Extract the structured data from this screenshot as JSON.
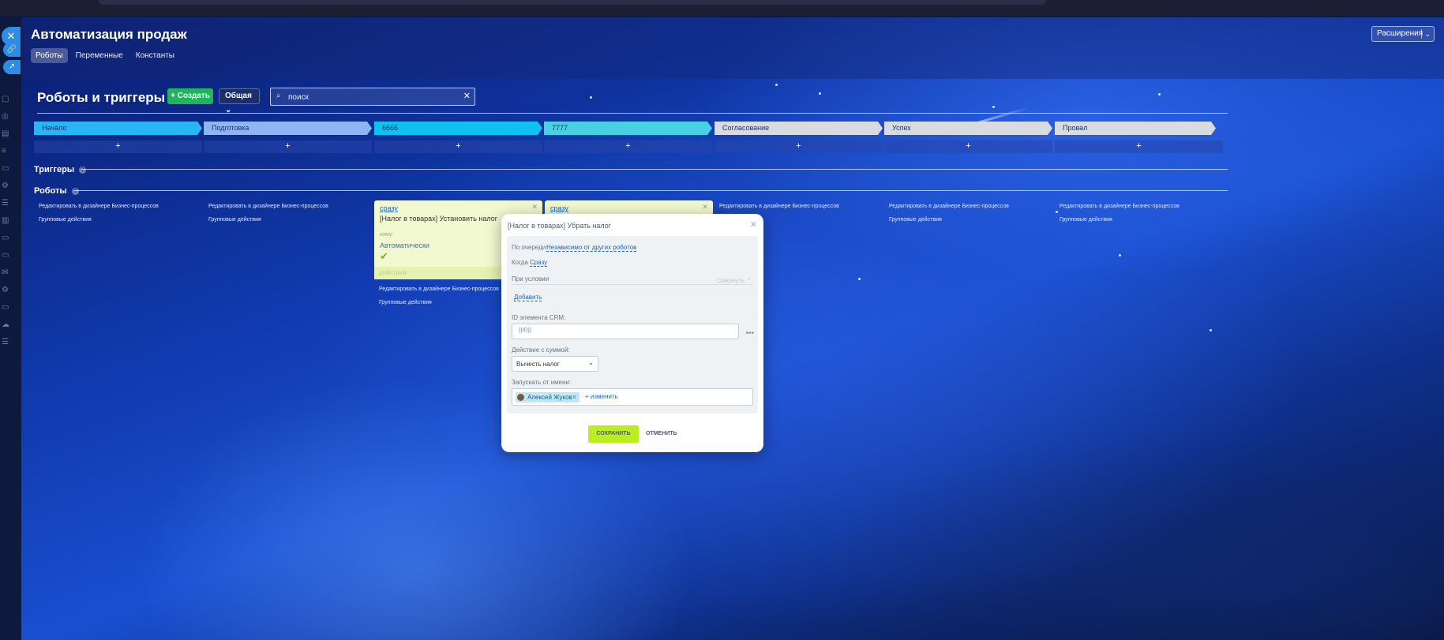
{
  "app": {
    "title": "Автоматизация продаж",
    "extensions_label": "Расширения",
    "tabs": [
      {
        "label": "Роботы",
        "active": true
      },
      {
        "label": "Переменные",
        "active": false
      },
      {
        "label": "Константы",
        "active": false
      }
    ]
  },
  "toolbar": {
    "section_title": "Роботы и триггеры",
    "create_label": "+ Создать",
    "general_label": "Общая",
    "search_placeholder": "поиск"
  },
  "stages": [
    {
      "name": "Начало",
      "color": "#29b6f6"
    },
    {
      "name": "Подготовка",
      "color": "#8fb5f5"
    },
    {
      "name": "6666",
      "color": "#10c0f0"
    },
    {
      "name": "7777",
      "color": "#47d1e2"
    },
    {
      "name": "Согласование",
      "color": "#d8dbe0"
    },
    {
      "name": "Успех",
      "color": "#d8dbe0"
    },
    {
      "name": "Провал",
      "color": "#d8dbe0"
    }
  ],
  "add_symbol": "+",
  "sections": {
    "triggers_label": "Триггеры",
    "robots_label": "Роботы",
    "help_icon": "?"
  },
  "column_links": {
    "edit_in_designer": "Редактировать в дизайнере Бизнес-процессов",
    "group_actions": "Групповые действия"
  },
  "robot_cards": [
    {
      "when": "сразу",
      "name": "[Налог в товарах] Установить налог",
      "to_label": "кому:",
      "to_value": "Автоматически",
      "footer": "действия"
    },
    {
      "when": "сразу"
    }
  ],
  "dialog": {
    "title": "[Налог в товарах] Убрать налог",
    "queue_label": "По очереди",
    "queue_value": "Независимо от других роботов",
    "when_label": "Когда",
    "when_value": "Сразу",
    "condition_label": "При условии",
    "collapse_label": "Свернуть",
    "add_label": "Добавить",
    "crm_id_label": "ID элемента CRM:",
    "crm_id_value": "{{ID}}",
    "sum_action_label": "Действие с суммой:",
    "sum_action_value": "Вычесть налог",
    "run_as_label": "Запускать от имени:",
    "run_as_user": "Алексей Жуков",
    "change_label": "+ изменить",
    "save_label": "СОХРАНИТЬ",
    "cancel_label": "ОТМЕНИТЬ"
  },
  "colors": {
    "accent_green": "#1fb55a",
    "save_green": "#bbed21",
    "link_blue": "#2067b0"
  }
}
